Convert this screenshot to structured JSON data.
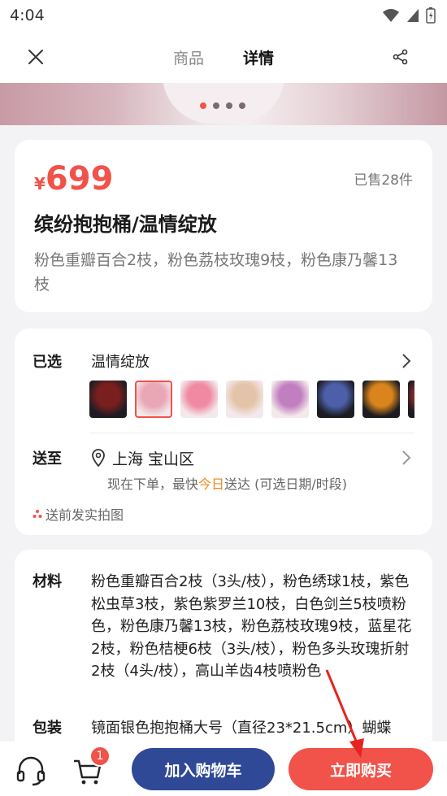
{
  "status_bar": {
    "time": "4:04"
  },
  "nav": {
    "tabs": [
      "商品",
      "详情"
    ],
    "active_tab": 1
  },
  "hero": {
    "dots": 4,
    "active_dot": 0
  },
  "product": {
    "price_symbol": "¥",
    "price": "699",
    "sold": "已售28件",
    "title": "缤纷抱抱桶/温情绽放",
    "subtitle": "粉色重瓣百合2枝，粉色荔枝玫瑰9枝，粉色康乃馨13枝"
  },
  "selection": {
    "label": "已选",
    "value": "温情绽放",
    "thumb_colors": [
      "#7a1f1f",
      "#e9a6b4",
      "#ef8aa2",
      "#e5c3a8",
      "#c27fc0",
      "#4c5fa8",
      "#d9841c",
      "#9c2d2d"
    ],
    "selected_thumb": 1
  },
  "shipping": {
    "label": "送至",
    "address": "上海 宝山区",
    "note_prefix": "现在下单，最快",
    "note_today": "今日",
    "note_suffix": "送达 (可选日期/时段)",
    "photo_note": "送前发实拍图"
  },
  "details": {
    "material_label": "材料",
    "material_text": "粉色重瓣百合2枝（3头/枝），粉色绣球1枝，紫色松虫草3枝，紫色紫罗兰10枝，白色剑兰5枝喷粉色，粉色康乃馨13枝，粉色荔枝玫瑰9枝，蓝星花2枝，粉色桔梗6枝（3头/枝），粉色多头玫瑰折射2枝（4头/枝），高山羊齿4枝喷粉色",
    "package_label": "包装",
    "package_text": "镜面银色抱抱桶大号（直径23*21.5cm）蝴蝶"
  },
  "bottom_bar": {
    "cart_badge": "1",
    "add_to_cart": "加入购物车",
    "buy_now": "立即购买"
  },
  "colors": {
    "accent": "#f1524a",
    "primary_button": "#2f4996",
    "today": "#f08a1e"
  }
}
